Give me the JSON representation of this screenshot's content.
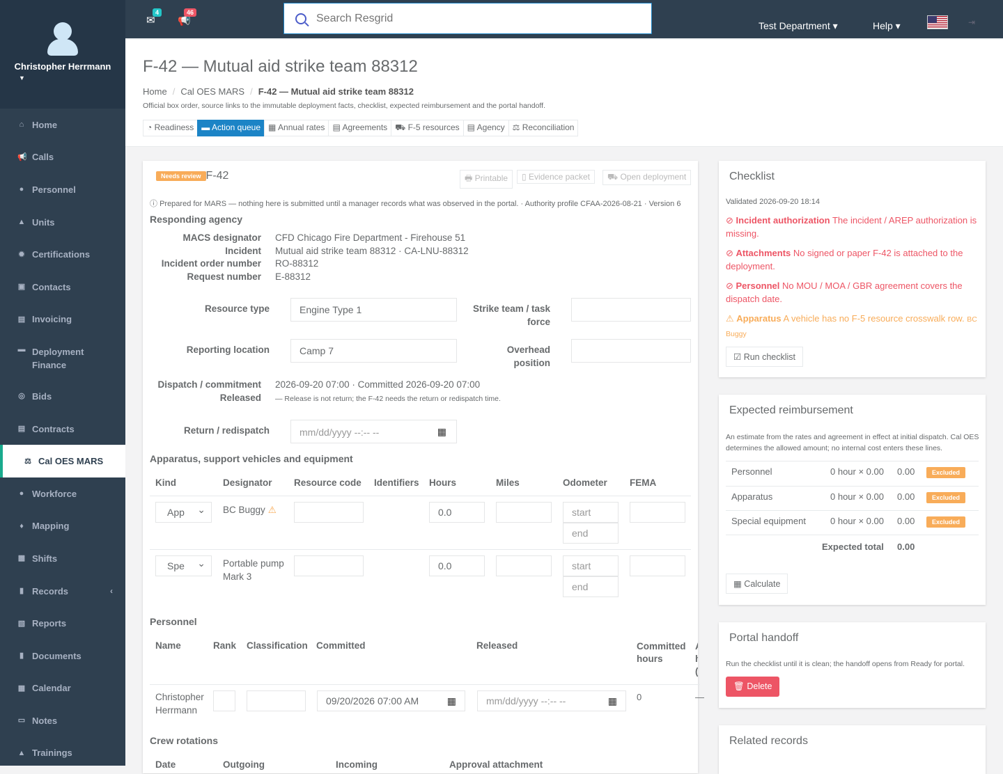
{
  "user": {
    "name": "Christopher Herrmann"
  },
  "nav": [
    {
      "label": "Home",
      "icon": "home-icon",
      "glyph": "⌂"
    },
    {
      "label": "Calls",
      "icon": "bullhorn-icon",
      "glyph": "📢"
    },
    {
      "label": "Personnel",
      "icon": "user-icon",
      "glyph": "●"
    },
    {
      "label": "Units",
      "icon": "road-icon",
      "glyph": "▲"
    },
    {
      "label": "Certifications",
      "icon": "certificate-icon",
      "glyph": "✹"
    },
    {
      "label": "Contacts",
      "icon": "contacts-icon",
      "glyph": "▣"
    },
    {
      "label": "Invoicing",
      "icon": "invoice-icon",
      "glyph": "▤"
    },
    {
      "label": "Deployment Finance",
      "icon": "truck-icon",
      "glyph": "▬"
    },
    {
      "label": "Bids",
      "icon": "handshake-icon",
      "glyph": "◎"
    },
    {
      "label": "Contracts",
      "icon": "contract-icon",
      "glyph": "▤"
    },
    {
      "label": "Cal OES MARS",
      "icon": "balance-scale-icon",
      "glyph": "⚖"
    },
    {
      "label": "Workforce",
      "icon": "users-icon",
      "glyph": "●"
    },
    {
      "label": "Mapping",
      "icon": "map-marker-icon",
      "glyph": "♦"
    },
    {
      "label": "Shifts",
      "icon": "shifts-icon",
      "glyph": "▩"
    },
    {
      "label": "Records",
      "icon": "file-icon",
      "glyph": "▮"
    },
    {
      "label": "Reports",
      "icon": "reports-icon",
      "glyph": "▧"
    },
    {
      "label": "Documents",
      "icon": "documents-icon",
      "glyph": "▮"
    },
    {
      "label": "Calendar",
      "icon": "calendar-icon",
      "glyph": "▦"
    },
    {
      "label": "Notes",
      "icon": "notes-icon",
      "glyph": "▭"
    },
    {
      "label": "Trainings",
      "icon": "trainings-icon",
      "glyph": "▲"
    }
  ],
  "topbar": {
    "mail_count": "4",
    "alert_count": "46",
    "search_placeholder": "Search Resgrid",
    "department": "Test Department",
    "help": "Help"
  },
  "page": {
    "title": "F-42 — Mutual aid strike team 88312",
    "crumbs": [
      "Home",
      "Cal OES MARS",
      "F-42 — Mutual aid strike team 88312"
    ],
    "description": "Official box order, source links to the immutable deployment facts, checklist, expected reimbursement and the portal handoff.",
    "tabs": [
      "Readiness",
      "Action queue",
      "Annual rates",
      "Agreements",
      "F-5 resources",
      "Agency",
      "Reconciliation"
    ]
  },
  "form": {
    "status": "Needs review",
    "form_name": "F-42",
    "buttons": [
      "Printable",
      "Evidence packet",
      "Open deployment"
    ],
    "note": "Prepared for MARS — nothing here is submitted until a manager records what was observed in the portal. · Authority profile CFAA-2026-08-21 · Version 6",
    "agency_title": "Responding agency",
    "agency": [
      {
        "k": "MACS designator",
        "v": "CFD Chicago Fire Department - Firehouse 51"
      },
      {
        "k": "Incident",
        "v": "Mutual aid strike team 88312 · CA-LNU-88312"
      },
      {
        "k": "Incident order number",
        "v": "RO-88312"
      },
      {
        "k": "Request number",
        "v": "E-88312"
      }
    ],
    "resource_type_label": "Resource type",
    "resource_type": "Engine Type 1",
    "strike_team_label": "Strike team / task force",
    "strike_team": "",
    "reporting_location_label": "Reporting location",
    "reporting_location": "Camp 7",
    "overhead_label": "Overhead position",
    "overhead": "",
    "dispatch_label": "Dispatch / commitment",
    "dispatch_value": "2026-09-20 07:00 · Committed 2026-09-20 07:00",
    "released_label": "Released",
    "released_note": "— Release is not return; the F-42 needs the return or redispatch time.",
    "return_label": "Return / redispatch",
    "date_placeholder": "mm/dd/yyyy --:-- --",
    "apparatus_title": "Apparatus, support vehicles and equipment",
    "apparatus_cols": [
      "Kind",
      "Designator",
      "Resource code",
      "Identifiers",
      "Hours",
      "Miles",
      "Odometer",
      "FEMA"
    ],
    "apparatus_rows": [
      {
        "kind": "App",
        "designator": "BC Buggy",
        "hours": "0.0",
        "warn": true
      },
      {
        "kind": "Spe",
        "designator": "Portable pump Mark 3",
        "hours": "0.0",
        "warn": false
      }
    ],
    "odo_start": "start",
    "odo_end": "end",
    "personnel_title": "Personnel",
    "personnel_cols": [
      "Name",
      "Rank",
      "Classification",
      "Committed",
      "Released",
      "Committed hours",
      "Actual hours (DTRs)"
    ],
    "personnel_rows": [
      {
        "name": "Christopher Herrmann",
        "committed": "09/20/2026 07:00 AM",
        "released": "mm/dd/yyyy --:-- --",
        "hours": "0",
        "actual": "—"
      }
    ],
    "crew_title": "Crew rotations",
    "crew_cols": [
      "Date",
      "Outgoing",
      "Incoming",
      "Approval attachment"
    ]
  },
  "checklist": {
    "title": "Checklist",
    "validated": "Validated 2026-09-20 18:14",
    "items": [
      {
        "level": "error",
        "head": "Incident authorization",
        "text": "The incident / AREP authorization is missing."
      },
      {
        "level": "error",
        "head": "Attachments",
        "text": "No signed or paper F-42 is attached to the deployment."
      },
      {
        "level": "error",
        "head": "Personnel",
        "text": "No MOU / MOA / GBR agreement covers the dispatch date."
      },
      {
        "level": "warn",
        "head": "Apparatus",
        "text": "A vehicle has no F-5 resource crosswalk row.",
        "tag": "BC Buggy"
      }
    ],
    "button": "Run checklist"
  },
  "reimbursement": {
    "title": "Expected reimbursement",
    "note": "An estimate from the rates and agreement in effect at initial dispatch. Cal OES determines the allowed amount; no internal cost enters these lines.",
    "rows": [
      {
        "label": "Personnel",
        "calc": "0 hour × 0.00",
        "amount": "0.00",
        "badge": "Excluded"
      },
      {
        "label": "Apparatus",
        "calc": "0 hour × 0.00",
        "amount": "0.00",
        "badge": "Excluded"
      },
      {
        "label": "Special equipment",
        "calc": "0 hour × 0.00",
        "amount": "0.00",
        "badge": "Excluded"
      }
    ],
    "total_label": "Expected total",
    "total": "0.00",
    "button": "Calculate"
  },
  "handoff": {
    "title": "Portal handoff",
    "note": "Run the checklist until it is clean; the handoff opens from Ready for portal.",
    "button": "Delete"
  },
  "related": {
    "title": "Related records"
  },
  "colors": {
    "sidebar": "#2f4050",
    "accent": "#1c84c6",
    "danger": "#ed5565",
    "warning": "#f8ac59"
  }
}
